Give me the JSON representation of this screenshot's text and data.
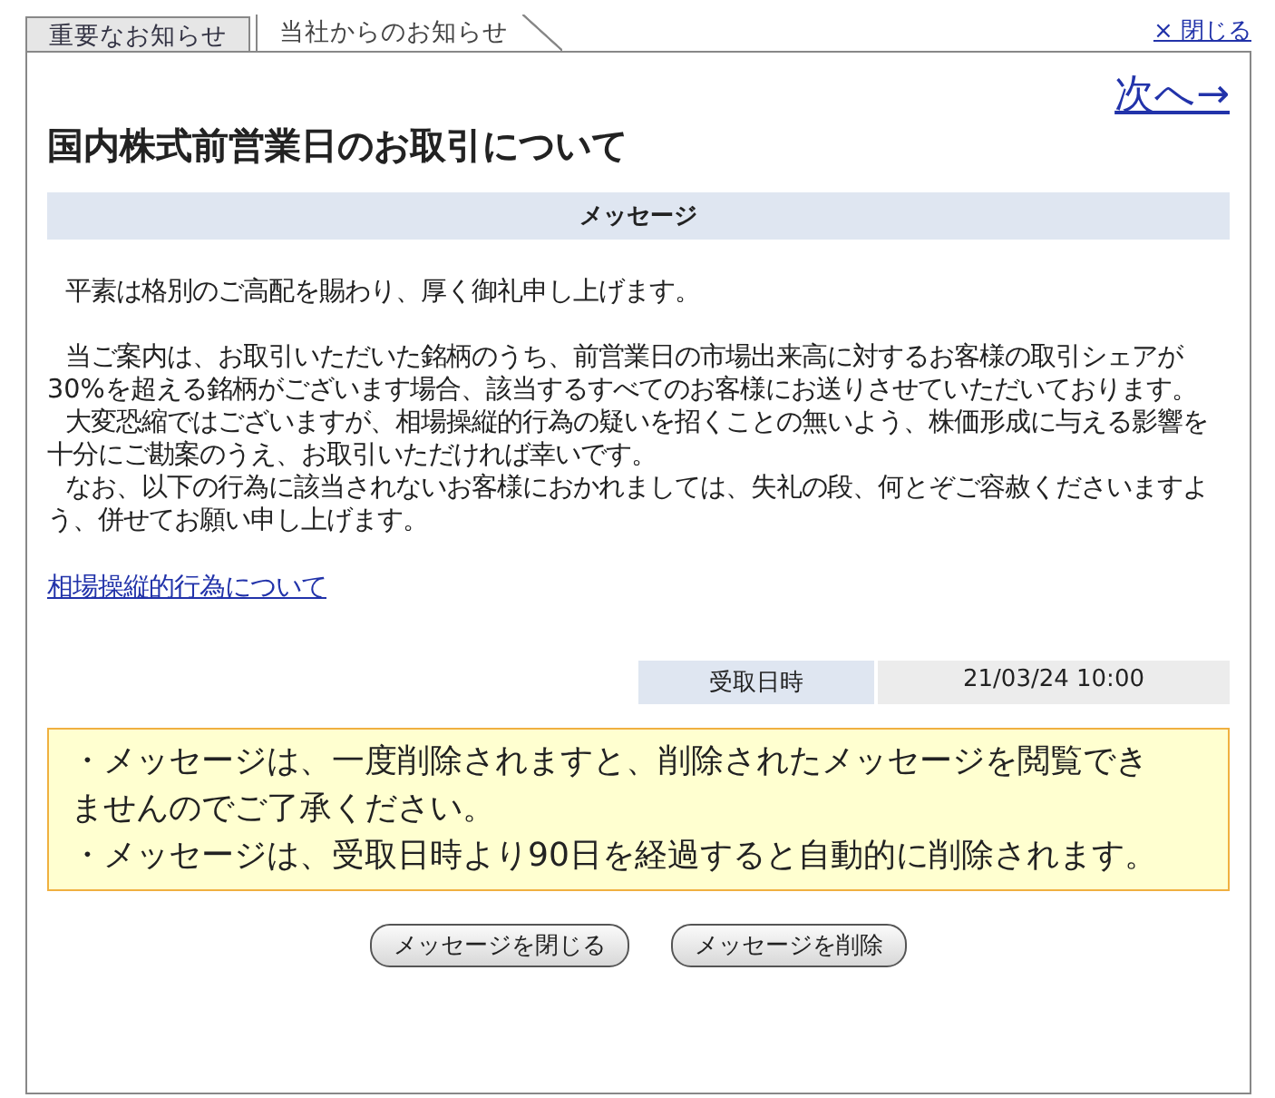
{
  "tabs": [
    {
      "label": "重要なお知らせ",
      "selected": false
    },
    {
      "label": "当社からのお知らせ",
      "selected": true
    }
  ],
  "close_link": "× 閉じる",
  "next_link": "次へ→",
  "title": "国内株式前営業日のお取引について",
  "message_header": "メッセージ",
  "paragraph_groups": [
    [
      "平素は格別のご高配を賜わり、厚く御礼申し上げます。"
    ],
    [
      "当ご案内は、お取引いただいた銘柄のうち、前営業日の市場出来高に対するお客様の取引シェアが30%を超える銘柄がございます場合、該当するすべてのお客様にお送りさせていただいております。",
      "大変恐縮ではございますが、相場操縦的行為の疑いを招くことの無いよう、株価形成に与える影響を十分にご勘案のうえ、お取引いただければ幸いです。",
      "なお、以下の行為に該当されないお客様におかれましては、失礼の段、何とぞご容赦くださいますよう、併せてお願い申し上げます。"
    ]
  ],
  "info_link": "相場操縦的行為について",
  "received": {
    "label": "受取日時",
    "value": "21/03/24 10:00"
  },
  "notices": [
    "・メッセージは、一度削除されますと、削除されたメッセージを閲覧できませんのでご了承ください。",
    "・メッセージは、受取日時より90日を経過すると自動的に削除されます。"
  ],
  "buttons": [
    "メッセージを閉じる",
    "メッセージを削除"
  ]
}
